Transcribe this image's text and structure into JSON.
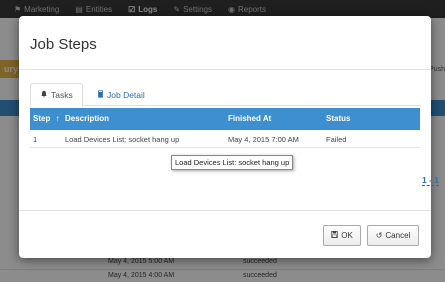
{
  "background": {
    "nav": [
      {
        "icon": "tag-icon",
        "glyph": "⚑",
        "label": "Marketing"
      },
      {
        "icon": "list-icon",
        "glyph": "▤",
        "label": "Entities"
      },
      {
        "icon": "check-icon",
        "glyph": "☑",
        "label": "Logs"
      },
      {
        "icon": "wrench-icon",
        "glyph": "✎",
        "label": "Settings"
      },
      {
        "icon": "report-icon",
        "glyph": "◉",
        "label": "Reports"
      }
    ],
    "banner_text": "ury",
    "push_text": "Push",
    "rows": [
      {
        "finished": "May 4, 2015 5:00 AM",
        "status": "succeeded"
      },
      {
        "finished": "May 4, 2015 4:00 AM",
        "status": "succeeded"
      }
    ]
  },
  "modal": {
    "title": "Job Steps",
    "tabs": [
      {
        "icon": "bell-icon",
        "glyph": "🔔",
        "label": "Tasks"
      },
      {
        "icon": "book-icon",
        "glyph": "▮",
        "label": "Job Detail"
      }
    ],
    "grid": {
      "headers": {
        "step": "Step",
        "sort": "↑",
        "description": "Description",
        "finished": "Finished At",
        "status": "Status"
      },
      "rows": [
        {
          "step": "1",
          "description": "Load Devices List: socket hang up",
          "finished": "May 4, 2015 7:00 AM",
          "status": "Failed"
        }
      ]
    },
    "tooltip": "Load Devices List: socket hang up",
    "pager": "1 - 1",
    "buttons": {
      "ok": {
        "glyph": "💾",
        "label": "OK"
      },
      "cancel": {
        "glyph": "↺",
        "label": "Cancel"
      }
    }
  }
}
